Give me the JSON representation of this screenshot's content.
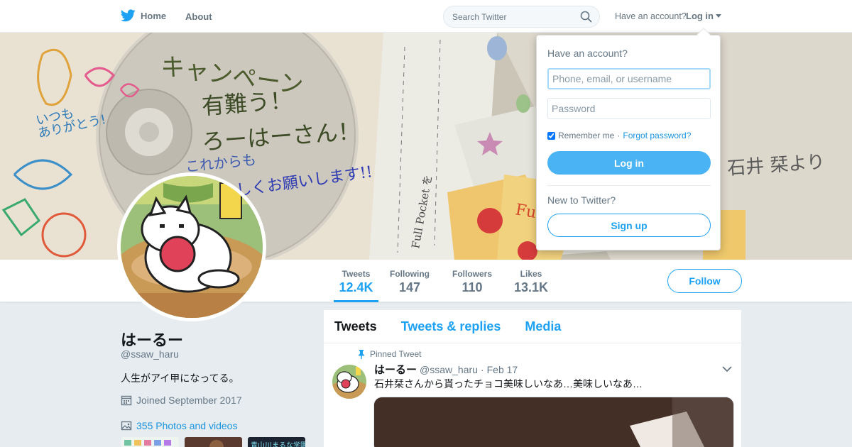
{
  "nav": {
    "home_label": "Home",
    "about_label": "About",
    "search_placeholder": "Search Twitter",
    "have_account_label": "Have an account?",
    "login_label": "Log in"
  },
  "profile": {
    "name": "はーるー",
    "handle": "@ssaw_haru",
    "bio": "人生がアイ甲になってる。",
    "joined": "Joined September 2017",
    "photos_label": "355 Photos and videos",
    "thumb_text": "青山川まるな学園 夕"
  },
  "stats": [
    {
      "label": "Tweets",
      "value": "12.4K"
    },
    {
      "label": "Following",
      "value": "147"
    },
    {
      "label": "Followers",
      "value": "110"
    },
    {
      "label": "Likes",
      "value": "13.1K"
    }
  ],
  "follow_label": "Follow",
  "banner": {
    "text_campaign": "キャンペーン",
    "text_arigatou": "有難う！",
    "text_haru": "ろーはーさん！",
    "text_korekara": "これからも",
    "text_yoroshiku": "よろしくお願いします!!",
    "text_itsumo": "いつも",
    "text_arigatou2": "ありがとう!",
    "text_signature": "石井 栞より",
    "text_fu": "Fu",
    "text_pocket": "Full Pocket を"
  },
  "timeline": {
    "tabs": [
      "Tweets",
      "Tweets & replies",
      "Media"
    ],
    "pinned_label": "Pinned Tweet",
    "tweet": {
      "name": "はーるー",
      "handle": "@ssaw_haru",
      "separator": "·",
      "date": "Feb 17",
      "text": "石井栞さんから貰ったチョコ美味しいなあ…美味しいなあ…"
    }
  },
  "login_dropdown": {
    "title": "Have an account?",
    "username_placeholder": "Phone, email, or username",
    "password_placeholder": "Password",
    "remember_label": "Remember me",
    "separator": "·",
    "forgot_label": "Forgot password?",
    "login_button": "Log in",
    "new_label": "New to Twitter?",
    "signup_button": "Sign up"
  },
  "colors": {
    "accent": "#1da1f2",
    "login_button": "#4ab3f4",
    "page_bg": "#e6ecf0"
  }
}
